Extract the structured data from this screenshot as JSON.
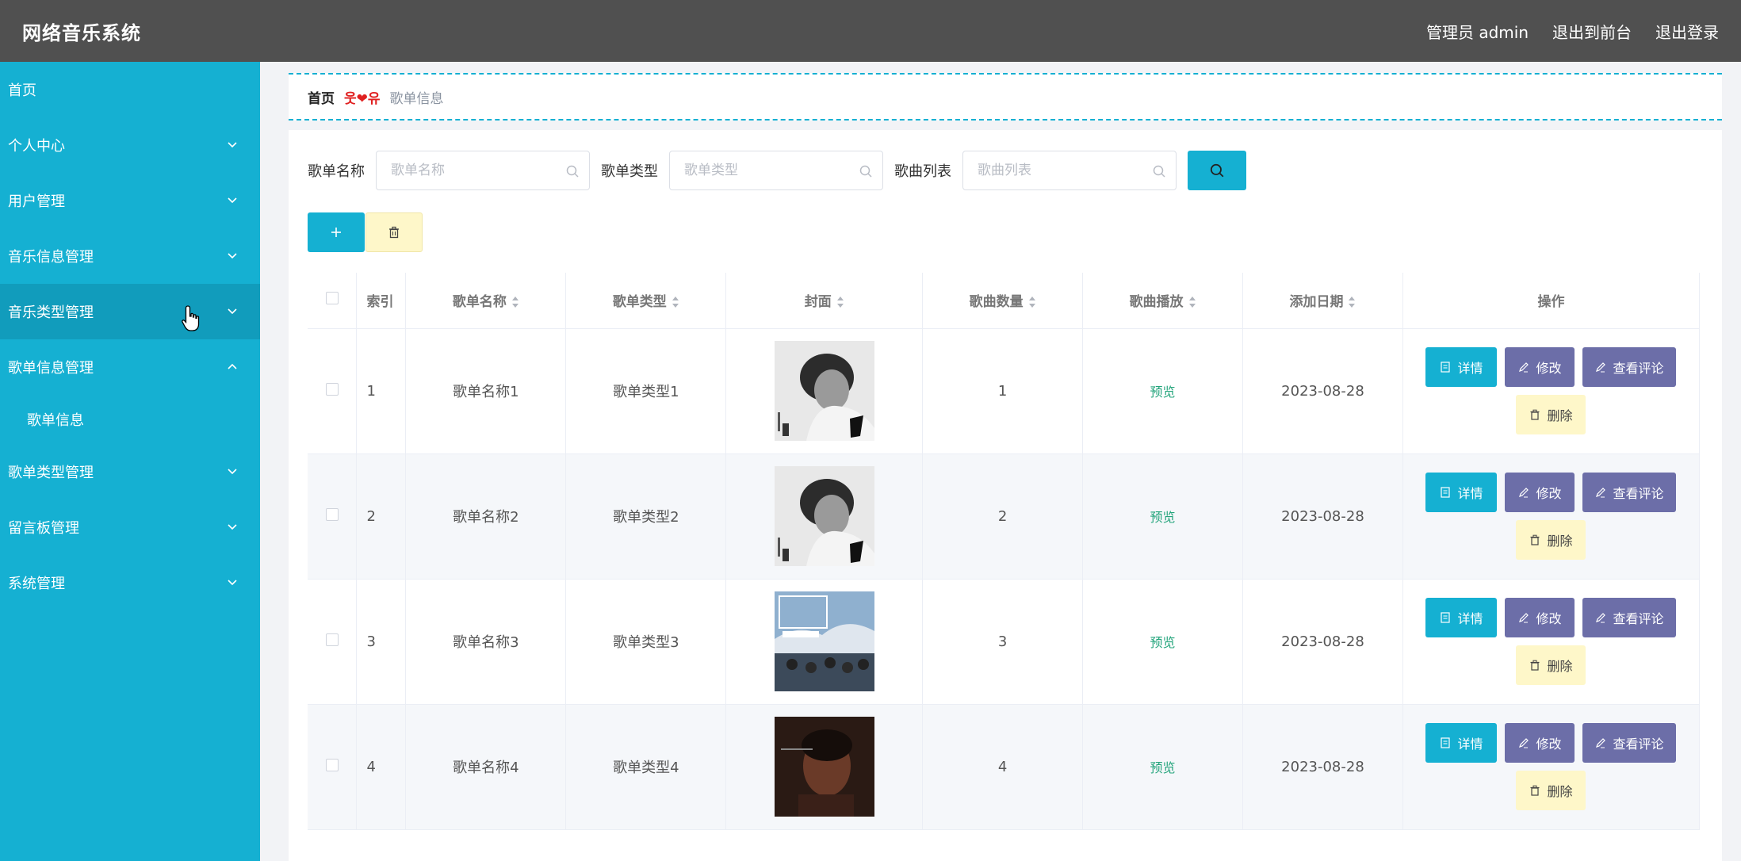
{
  "app": {
    "title": "网络音乐系统"
  },
  "header": {
    "user": "管理员 admin",
    "front": "退出到前台",
    "logout": "退出登录"
  },
  "sidebar": {
    "items": [
      {
        "label": "首页",
        "chevron": false
      },
      {
        "label": "个人中心",
        "chevron": "down"
      },
      {
        "label": "用户管理",
        "chevron": "down"
      },
      {
        "label": "音乐信息管理",
        "chevron": "down"
      },
      {
        "label": "音乐类型管理",
        "chevron": "down"
      },
      {
        "label": "歌单信息管理",
        "chevron": "up"
      },
      {
        "label": "歌单类型管理",
        "chevron": "down"
      },
      {
        "label": "留言板管理",
        "chevron": "down"
      },
      {
        "label": "系统管理",
        "chevron": "down"
      }
    ],
    "submenu": {
      "label": "歌单信息"
    }
  },
  "breadcrumb": {
    "home": "首页",
    "separator": "웃❤유",
    "current": "歌单信息"
  },
  "search": {
    "name_label": "歌单名称",
    "name_placeholder": "歌单名称",
    "type_label": "歌单类型",
    "type_placeholder": "歌单类型",
    "list_label": "歌曲列表",
    "list_placeholder": "歌曲列表"
  },
  "table": {
    "columns": [
      "索引",
      "歌单名称",
      "歌单类型",
      "封面",
      "歌曲数量",
      "歌曲播放",
      "添加日期",
      "操作"
    ],
    "rows": [
      {
        "index": "1",
        "name": "歌单名称1",
        "type": "歌单类型1",
        "count": "1",
        "play": "预览",
        "date": "2023-08-28",
        "cover": "portrait-gray"
      },
      {
        "index": "2",
        "name": "歌单名称2",
        "type": "歌单类型2",
        "count": "2",
        "play": "预览",
        "date": "2023-08-28",
        "cover": "portrait-gray"
      },
      {
        "index": "3",
        "name": "歌单名称3",
        "type": "歌单类型3",
        "count": "3",
        "play": "预览",
        "date": "2023-08-28",
        "cover": "band-sky"
      },
      {
        "index": "4",
        "name": "歌单名称4",
        "type": "歌单类型4",
        "count": "4",
        "play": "预览",
        "date": "2023-08-28",
        "cover": "portrait-dark"
      }
    ],
    "ops": {
      "detail": "详情",
      "edit": "修改",
      "comment": "查看评论",
      "delete": "删除"
    }
  },
  "colors": {
    "accent": "#15b0d2",
    "topbar": "#505050",
    "purple": "#6c6ea8",
    "yellow": "#fef7c9"
  }
}
